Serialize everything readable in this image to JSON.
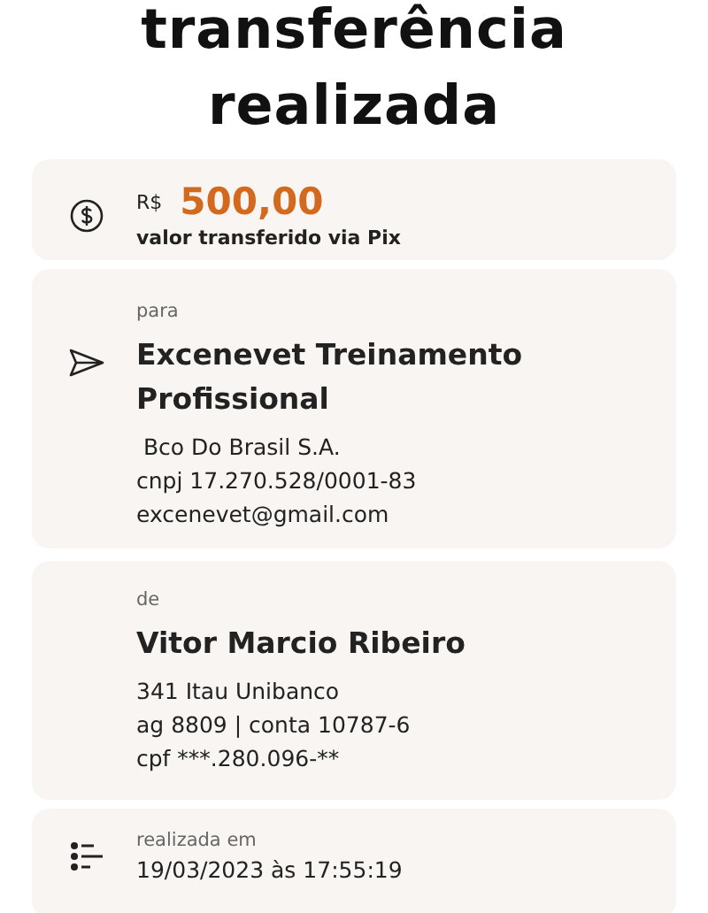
{
  "title": [
    "transferência",
    "realizada"
  ],
  "cards": [
    {
      "kind": "amount",
      "currency": "R$",
      "amount": "500,00",
      "caption": "valor transferido via Pix"
    },
    {
      "kind": "send",
      "label": "para",
      "name": "Excenevet Treinamento Profissional",
      "lines": [
        " Bco Do Brasil S.A.",
        "cnpj 17.270.528/0001-83",
        "excenevet@gmail.com"
      ]
    },
    {
      "kind": "person",
      "label": "de",
      "name": "Vitor Marcio Ribeiro",
      "lines": [
        "341 Itau Unibanco",
        "ag 8809 | conta 10787-6",
        "cpf ***.280.096-**"
      ]
    },
    {
      "kind": "date",
      "label": "realizada em",
      "value": "19/03/2023 às 17:55:19"
    }
  ]
}
